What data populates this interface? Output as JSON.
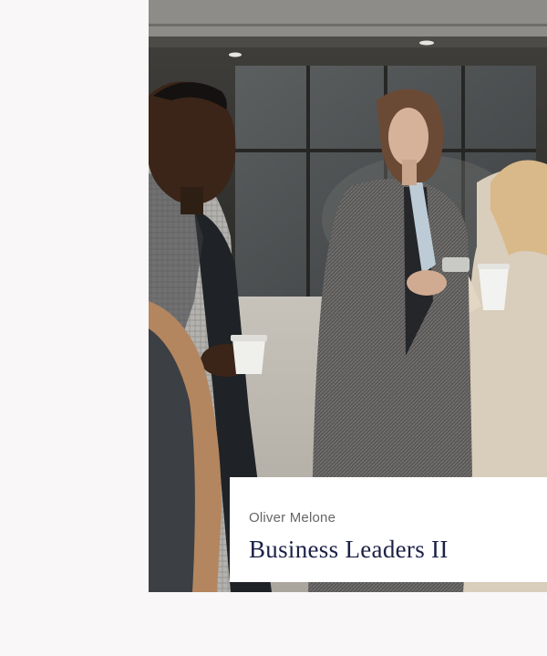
{
  "portfolio_item": {
    "photo": {
      "icon": "business-people-walking-photo"
    },
    "caption": {
      "author": "Oliver Melone",
      "title": "Business Leaders II"
    }
  },
  "colors": {
    "background": "#f9f7f7",
    "card": "#ffffff",
    "title": "#1b2147",
    "author": "#666666"
  }
}
